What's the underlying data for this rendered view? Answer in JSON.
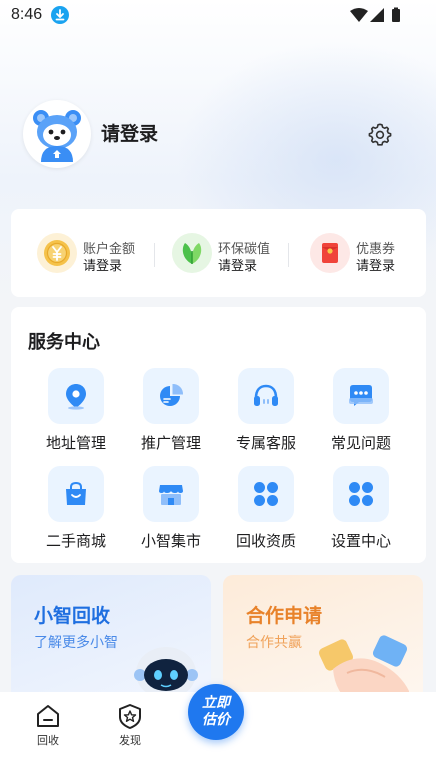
{
  "status_bar": {
    "time": "8:46"
  },
  "profile": {
    "login_text": "请登录"
  },
  "account": {
    "items": [
      {
        "label": "账户金额",
        "value": "请登录",
        "icon": "coin-icon"
      },
      {
        "label": "环保碳值",
        "value": "请登录",
        "icon": "leaf-icon"
      },
      {
        "label": "优惠券",
        "value": "请登录",
        "icon": "red-envelope-icon"
      }
    ]
  },
  "services": {
    "title": "服务中心",
    "items": [
      {
        "label": "地址管理",
        "icon": "location-pin-icon"
      },
      {
        "label": "推广管理",
        "icon": "pie-chart-icon"
      },
      {
        "label": "专属客服",
        "icon": "headset-icon"
      },
      {
        "label": "常见问题",
        "icon": "chat-bubble-icon"
      },
      {
        "label": "二手商城",
        "icon": "shopping-bag-icon"
      },
      {
        "label": "小智集市",
        "icon": "storefront-icon"
      },
      {
        "label": "回收资质",
        "icon": "four-petal-icon"
      },
      {
        "label": "设置中心",
        "icon": "four-petal-icon"
      }
    ],
    "accent": "#2f8af5"
  },
  "banners": {
    "left": {
      "title": "小智回收",
      "subtitle": "了解更多小智",
      "color": "#1f6fe0"
    },
    "right": {
      "title": "合作申请",
      "subtitle": "合作共赢",
      "color": "#e8822a"
    }
  },
  "bottom_nav": {
    "items": [
      {
        "label": "回收",
        "icon": "home-icon"
      },
      {
        "label": "发现",
        "icon": "discover-icon"
      }
    ],
    "center": {
      "line1": "立即",
      "line2": "估价"
    }
  }
}
